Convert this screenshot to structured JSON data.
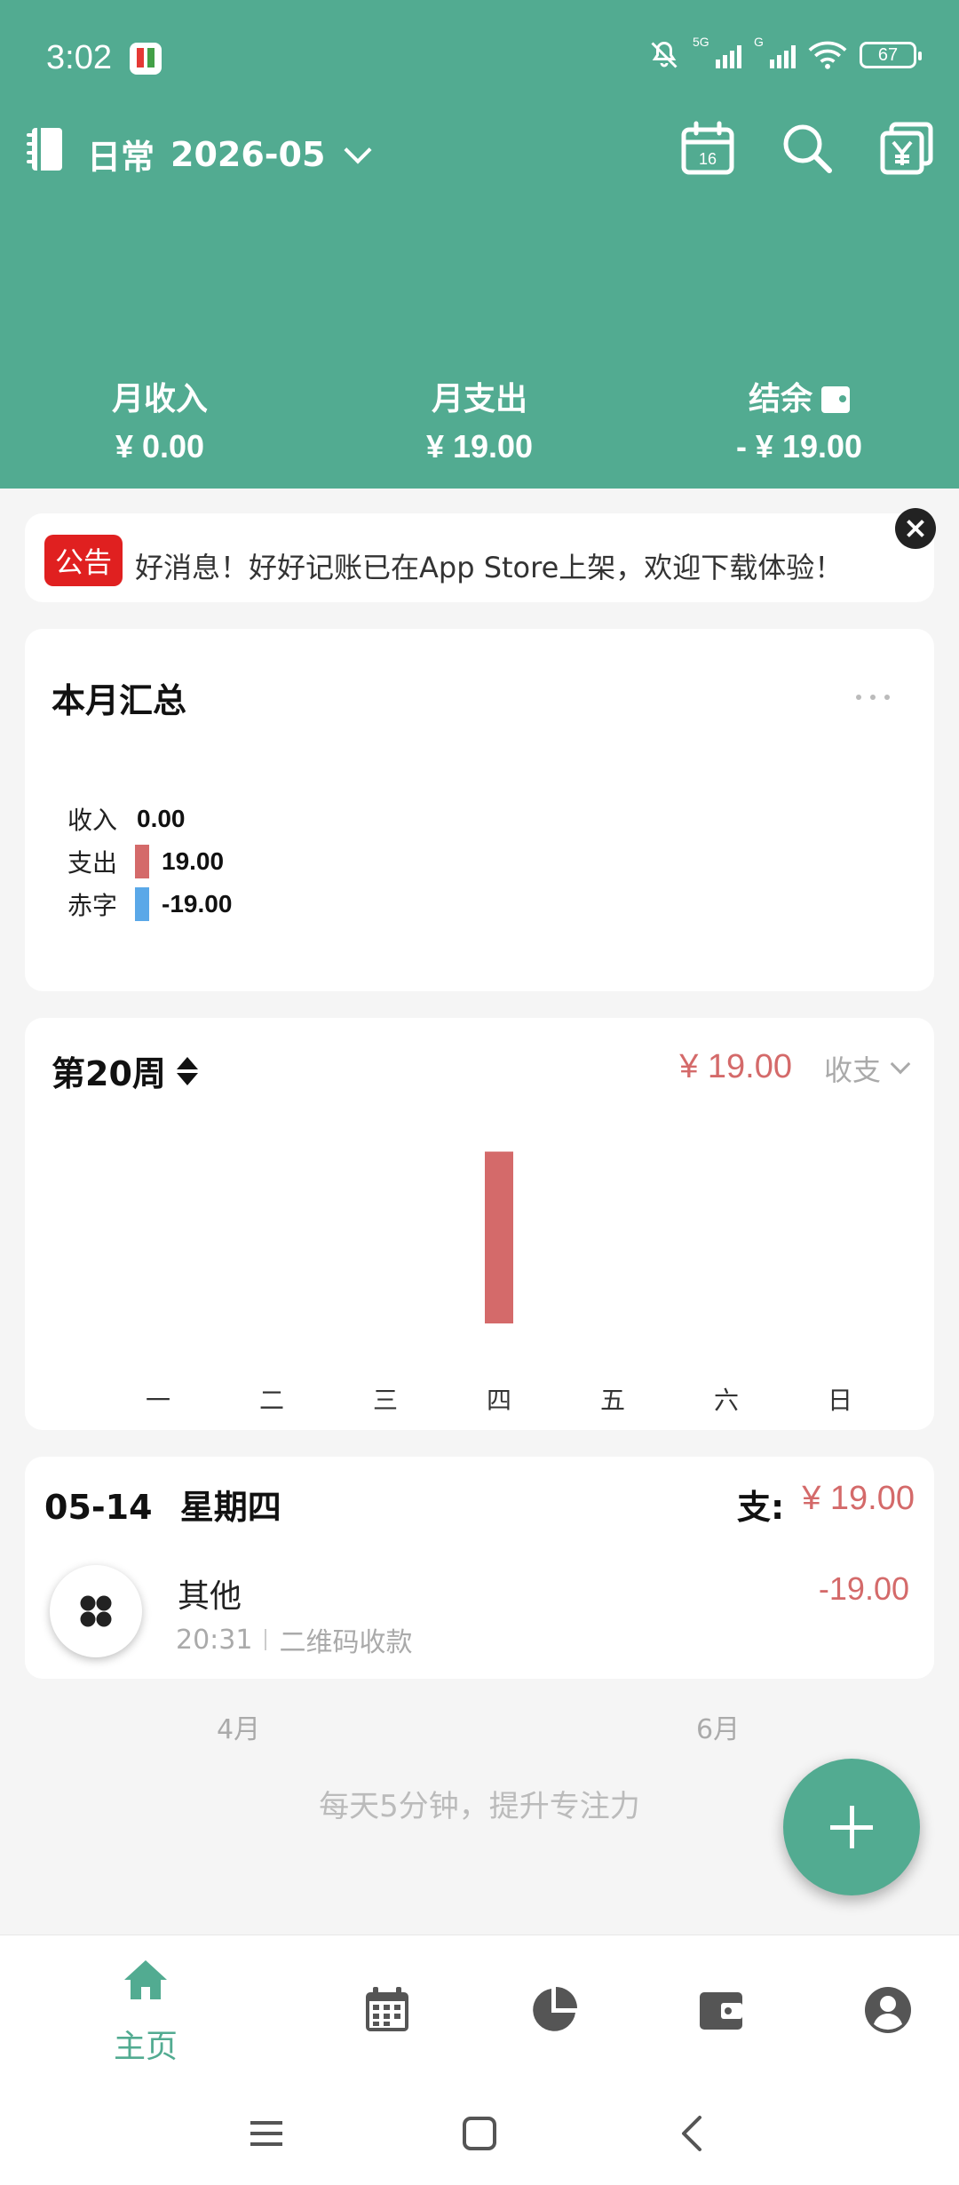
{
  "status_bar": {
    "time": "3:02",
    "network_1": "5G",
    "network_2": "G",
    "battery": "67"
  },
  "topbar": {
    "book_name": "日常",
    "period": "2026-05",
    "calendar_day": "16"
  },
  "summary": {
    "income_label": "月收入",
    "income_value": "¥ 0.00",
    "expense_label": "月支出",
    "expense_value": "¥ 19.00",
    "balance_label": "结余",
    "balance_value": "- ¥ 19.00"
  },
  "notice": {
    "badge": "公告",
    "text": "好消息！好好记账已在App Store上架，欢迎下载体验！"
  },
  "monthly_summary": {
    "title": "本月汇总",
    "rows": [
      {
        "label": "收入",
        "value": "0.00",
        "color": ""
      },
      {
        "label": "支出",
        "value": "19.00",
        "color": "#d46a6a"
      },
      {
        "label": "赤字",
        "value": "-19.00",
        "color": "#5aa8e8"
      }
    ]
  },
  "weekly": {
    "week_label": "第20周",
    "amount": "¥ 19.00",
    "filter": "收支",
    "chart_data": {
      "type": "bar",
      "categories": [
        "一",
        "二",
        "三",
        "四",
        "五",
        "六",
        "日"
      ],
      "values": [
        0,
        0,
        0,
        19,
        0,
        0,
        0
      ],
      "ylim": [
        0,
        22
      ],
      "bar_color": "#d46a6a",
      "grid": false
    }
  },
  "day_group": {
    "date": "05-14",
    "weekday": "星期四",
    "total_label": "支:",
    "total_value": "¥ 19.00",
    "transactions": [
      {
        "category": "其他",
        "time": "20:31",
        "note": "二维码收款",
        "amount": "-19.00",
        "icon": "clover-icon"
      }
    ]
  },
  "month_nav": {
    "prev": "4月",
    "next": "6月"
  },
  "slogan": "每天5分钟，提升专注力",
  "bottom_nav": {
    "items": [
      {
        "label": "主页",
        "icon": "home-icon",
        "active": true
      },
      {
        "label": "",
        "icon": "calendar-icon",
        "active": false
      },
      {
        "label": "",
        "icon": "pie-chart-icon",
        "active": false
      },
      {
        "label": "",
        "icon": "wallet-icon",
        "active": false
      },
      {
        "label": "",
        "icon": "profile-icon",
        "active": false
      }
    ]
  },
  "colors": {
    "primary": "#52ab91",
    "expense": "#d46a6a",
    "deficit": "#5aa8e8",
    "notice_badge": "#e02020"
  }
}
